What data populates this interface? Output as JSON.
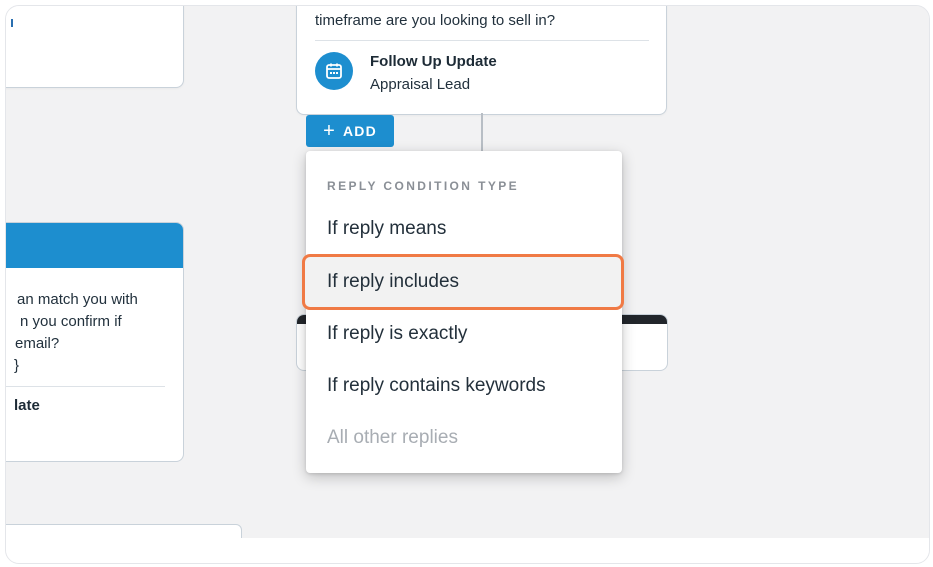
{
  "canvas": {
    "top_node": {
      "question_tail": "timeframe are you looking to sell in?",
      "action_icon": "calendar-icon",
      "action_title": "Follow Up Update",
      "action_subtitle": "Appraisal Lead"
    },
    "add_button": {
      "icon": "plus-icon",
      "label": "ADD"
    },
    "left_node": {
      "text_lines": [
        "an match you with",
        "n you confirm if",
        "email?",
        "}"
      ],
      "action_title_fragment": "late"
    }
  },
  "dropdown": {
    "heading": "REPLY CONDITION TYPE",
    "items": [
      {
        "label": "If reply means",
        "disabled": false
      },
      {
        "label": "If reply includes",
        "disabled": false,
        "highlighted": true
      },
      {
        "label": "If reply is exactly",
        "disabled": false
      },
      {
        "label": "If reply contains keywords",
        "disabled": false
      },
      {
        "label": "All other replies",
        "disabled": true
      }
    ]
  },
  "colors": {
    "accent": "#1d8ecf",
    "highlight_border": "#f07a45",
    "disabled_text": "#a8adb3"
  }
}
